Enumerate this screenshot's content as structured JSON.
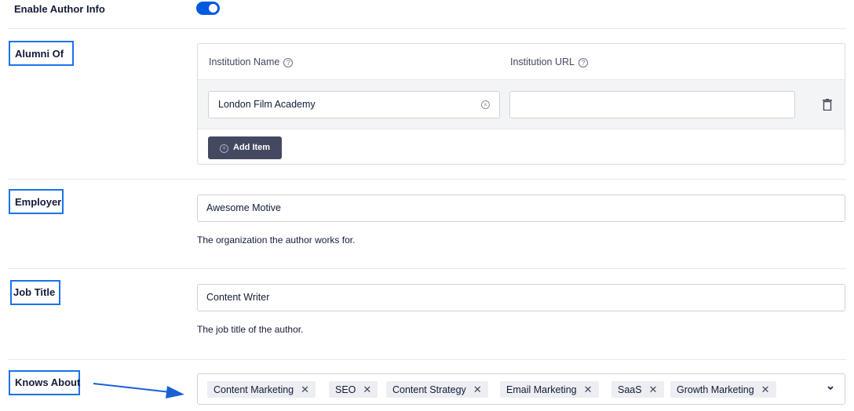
{
  "enable_author_info": {
    "label": "Enable Author Info",
    "enabled": true
  },
  "alumni_of": {
    "label": "Alumni Of",
    "columns": {
      "institution_name": "Institution Name",
      "institution_url": "Institution URL"
    },
    "rows": [
      {
        "institution_name": "London Film Academy",
        "institution_url": ""
      }
    ],
    "add_button": "Add Item"
  },
  "employer": {
    "label": "Employer",
    "value": "Awesome Motive",
    "description": "The organization the author works for."
  },
  "job_title": {
    "label": "Job Title",
    "value": "Content Writer",
    "description": "The job title of the author."
  },
  "knows_about": {
    "label": "Knows About",
    "tags": [
      "Content Marketing",
      "SEO",
      "Content Strategy",
      "Email Marketing",
      "SaaS",
      "Growth Marketing"
    ]
  },
  "colors": {
    "accent": "#005ae0",
    "highlight_box": "#1a73e8",
    "button": "#434960"
  },
  "icons": {
    "help": "help-circle-icon",
    "clear": "clear-icon",
    "delete": "trash-icon",
    "add": "plus-circle-icon",
    "remove_tag": "close-icon",
    "dropdown": "chevron-down-icon"
  }
}
